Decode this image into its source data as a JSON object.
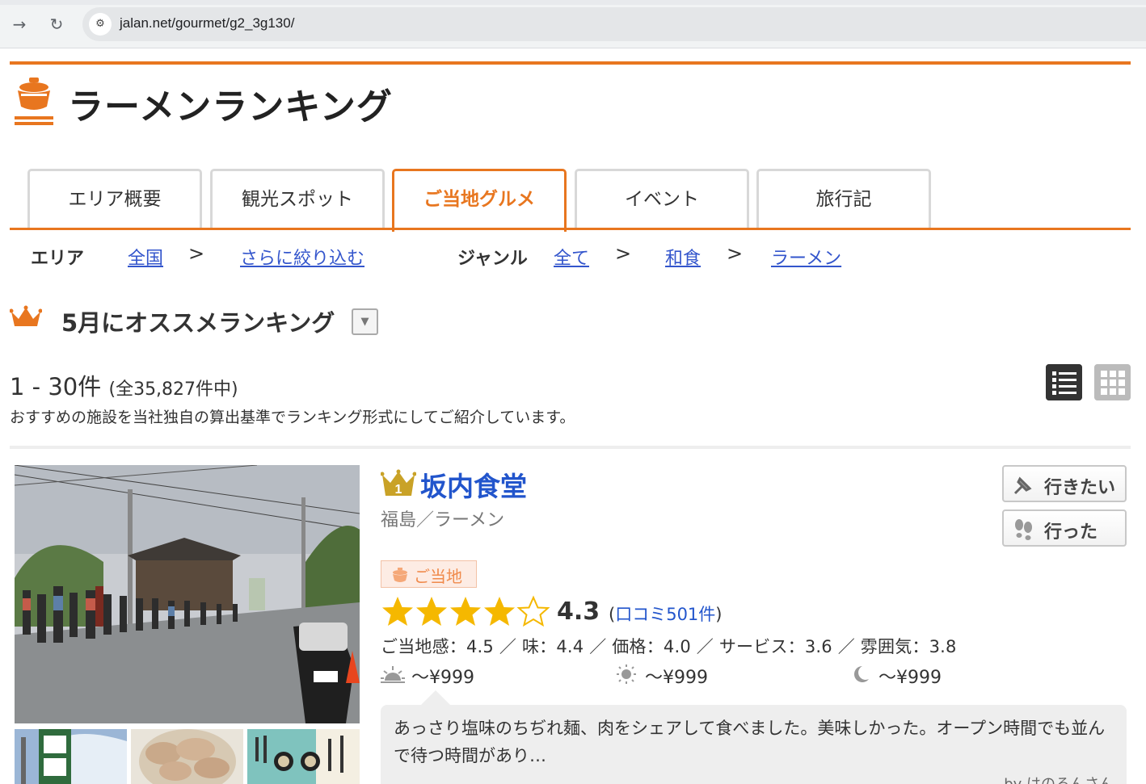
{
  "browser": {
    "url": "jalan.net/gourmet/g2_3g130/"
  },
  "page": {
    "title": "ラーメンランキング"
  },
  "tabs": [
    {
      "label": "エリア概要",
      "active": false
    },
    {
      "label": "観光スポット",
      "active": false
    },
    {
      "label": "ご当地グルメ",
      "active": true
    },
    {
      "label": "イベント",
      "active": false
    },
    {
      "label": "旅行記",
      "active": false
    }
  ],
  "filters": {
    "area_label": "エリア",
    "area_links": [
      "全国",
      "さらに絞り込む"
    ],
    "genre_label": "ジャンル",
    "genre_links": [
      "全て",
      "和食",
      "ラーメン"
    ],
    "separator": ">"
  },
  "ranking": {
    "heading": "5月にオススメランキング",
    "dropdown_glyph": "▼",
    "count_range": "1 - 30件",
    "count_total": "(全35,827件中)",
    "description": "おすすめの施設を当社独自の算出基準でランキング形式にしてご紹介しています。"
  },
  "colors": {
    "accent": "#e8761f",
    "link": "#2255cc",
    "star": "#f5b800"
  },
  "listing": {
    "rank": 1,
    "name": "坂内食堂",
    "area_genre": "福島／ラーメン",
    "badge": "ご当地",
    "rating": 4.3,
    "rating_label": "4.3",
    "reviews_open": "(",
    "reviews_link": "口コミ501件",
    "reviews_close": ")",
    "sub_scores": "ご当地感：4.5 ／ 味：4.4 ／ 価格：4.0 ／ サービス：3.6 ／ 雰囲気：3.8",
    "prices": [
      {
        "icon": "morning-sun-icon",
        "value": "～¥999"
      },
      {
        "icon": "sun-icon",
        "value": "～¥999"
      },
      {
        "icon": "moon-icon",
        "value": "～¥999"
      }
    ],
    "want_to_go": "行きたい",
    "went": "行った",
    "review_text": "あっさり塩味のちぢれ麺、肉をシェアして食べました。美味しかった。オープン時間でも並んで待つ時間があり…",
    "review_by": "by はのるんさん"
  }
}
